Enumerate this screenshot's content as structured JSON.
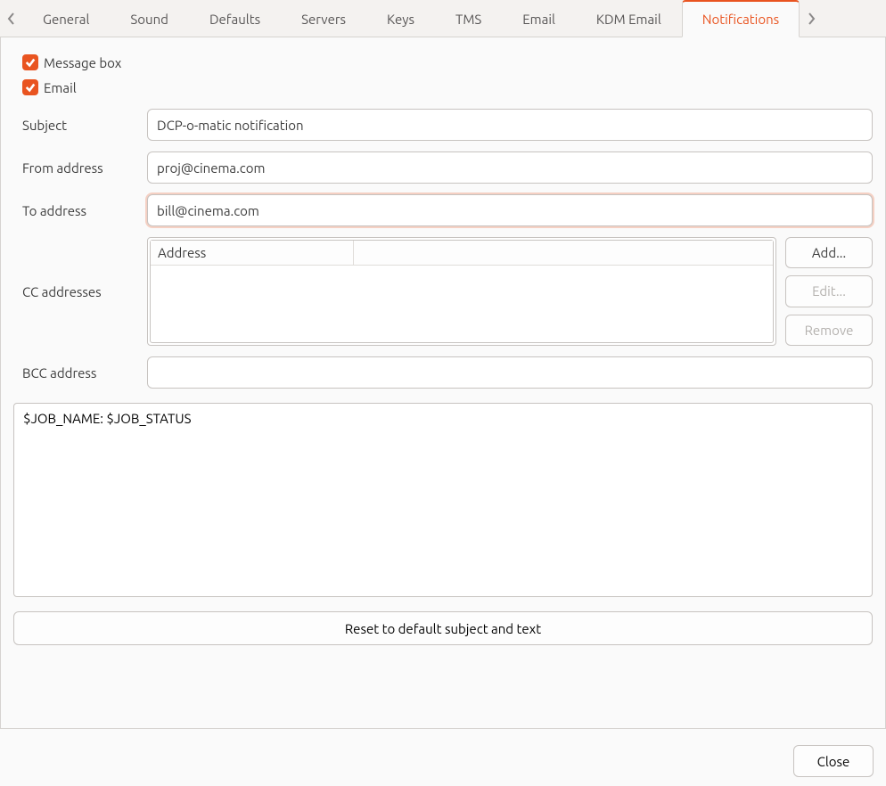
{
  "tabs": {
    "items": [
      {
        "label": "General"
      },
      {
        "label": "Sound"
      },
      {
        "label": "Defaults"
      },
      {
        "label": "Servers"
      },
      {
        "label": "Keys"
      },
      {
        "label": "TMS"
      },
      {
        "label": "Email"
      },
      {
        "label": "KDM Email"
      },
      {
        "label": "Notifications"
      }
    ],
    "active_index": 8
  },
  "checkboxes": {
    "message_box": {
      "label": "Message box",
      "checked": true
    },
    "email": {
      "label": "Email",
      "checked": true
    }
  },
  "form": {
    "subject": {
      "label": "Subject",
      "value": "DCP-o-matic notification"
    },
    "from": {
      "label": "From address",
      "value": "proj@cinema.com"
    },
    "to": {
      "label": "To address",
      "value": "bill@cinema.com"
    },
    "cc": {
      "label": "CC addresses",
      "header": "Address"
    },
    "bcc": {
      "label": "BCC address",
      "value": ""
    }
  },
  "cc_buttons": {
    "add": "Add...",
    "edit": "Edit...",
    "remove": "Remove"
  },
  "body_text": "$JOB_NAME: $JOB_STATUS",
  "reset_label": "Reset to default subject and text",
  "close_label": "Close",
  "colors": {
    "accent": "#e95420"
  }
}
